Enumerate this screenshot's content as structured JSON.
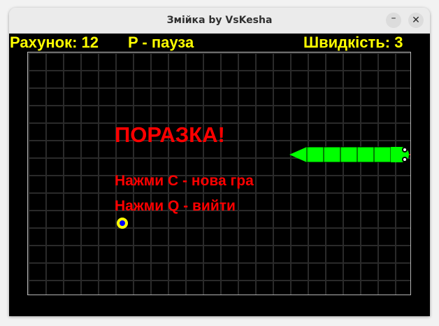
{
  "window": {
    "title": "Змійка by VsKesha",
    "minimize_glyph": "–",
    "close_glyph": "✕"
  },
  "hud": {
    "score": "Рахунок: 12",
    "pause_hint": "P - пауза",
    "speed": "Швидкість: 3"
  },
  "game_over": {
    "headline": "ПОРАЗКА!",
    "new_game": "Нажми C - нова гра",
    "quit": "Нажми Q - вийти"
  },
  "colors": {
    "hud_text": "#ffff00",
    "message_text": "#ff0000",
    "snake": "#00ff00",
    "grid": "#2a2a2a",
    "food": "#ffff00",
    "food_core": "#0000ff"
  },
  "icons": {
    "snake": "snake",
    "food": "food-pellet"
  }
}
